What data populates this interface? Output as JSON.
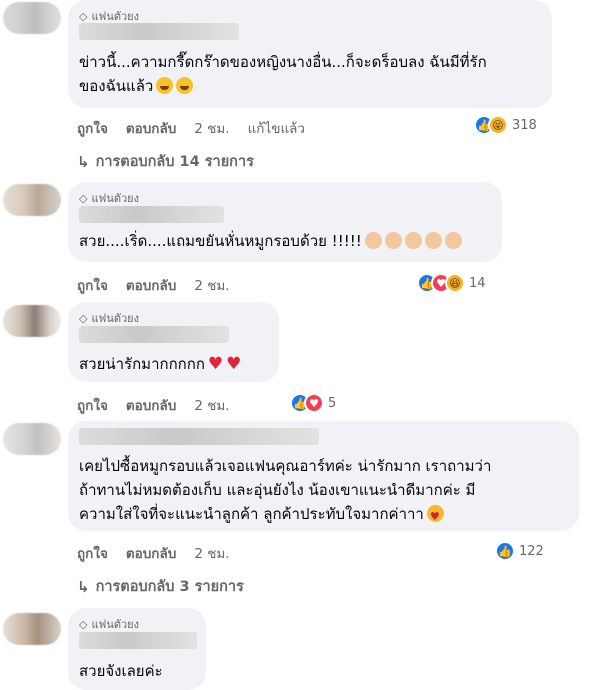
{
  "badge_label": "แฟนตัวยง",
  "comments": [
    {
      "text_lines": [
        "ข่าวนี้...ความกรี๊ดกร๊าดของหญิงนางอื่น...ก็จะดร็อบลง ฉันมีที่รัก",
        "ของฉันแล้ว"
      ],
      "emoji": [
        "grinning-squinting-face",
        "grinning-squinting-face"
      ],
      "actions": {
        "like": "ถูกใจ",
        "reply": "ตอบกลับ",
        "time": "2 ชม.",
        "edited": "แก้ไขแล้ว"
      },
      "reactions": {
        "icons": [
          "like-icon",
          "haha-icon"
        ],
        "count": "318"
      },
      "replies": "การตอบกลับ 14 รายการ"
    },
    {
      "text_lines": [
        "สวย....เริ่ด....แถมขยันหั่นหมูกรอบด้วย !!!!!"
      ],
      "emoji": [
        "clapping-hands",
        "clapping-hands",
        "clapping-hands",
        "clapping-hands",
        "clapping-hands"
      ],
      "actions": {
        "like": "ถูกใจ",
        "reply": "ตอบกลับ",
        "time": "2 ชม."
      },
      "reactions": {
        "icons": [
          "like-icon",
          "love-icon",
          "haha-icon"
        ],
        "count": "14"
      }
    },
    {
      "text_lines": [
        "สวยน่ารักมากกกกก"
      ],
      "emoji": [
        "red-heart",
        "red-heart"
      ],
      "actions": {
        "like": "ถูกใจ",
        "reply": "ตอบกลับ",
        "time": "2 ชม."
      },
      "reactions": {
        "icons": [
          "like-icon",
          "love-icon"
        ],
        "count": "5"
      }
    },
    {
      "text_lines": [
        "เคยไปซื้อหมูกรอบแล้วเจอแฟนคุณอาร์ทค่ะ น่ารักมาก เราถามว่า",
        "ถ้าทานไม่หมดต้องเก็บ และอุ่นยังไง น้องเขาแนะนำดีมากค่ะ มี",
        "ความใส่ใจที่จะแนะนำลูกค้า ลูกค้าประทับใจมากค่าาา"
      ],
      "emoji": [
        "smiling-face-with-hearts"
      ],
      "actions": {
        "like": "ถูกใจ",
        "reply": "ตอบกลับ",
        "time": "2 ชม."
      },
      "reactions": {
        "icons": [
          "like-icon"
        ],
        "count": "122"
      },
      "replies": "การตอบกลับ 3 รายการ"
    },
    {
      "text_lines": [
        "สวยจังเลยค่ะ"
      ],
      "emoji": [],
      "actions": {},
      "reactions": {}
    }
  ],
  "colors": {
    "bubble": "#f0f2f5",
    "meta": "#65676b",
    "like": "#1877f2",
    "love": "#f33e58",
    "haha": "#f7b125"
  }
}
